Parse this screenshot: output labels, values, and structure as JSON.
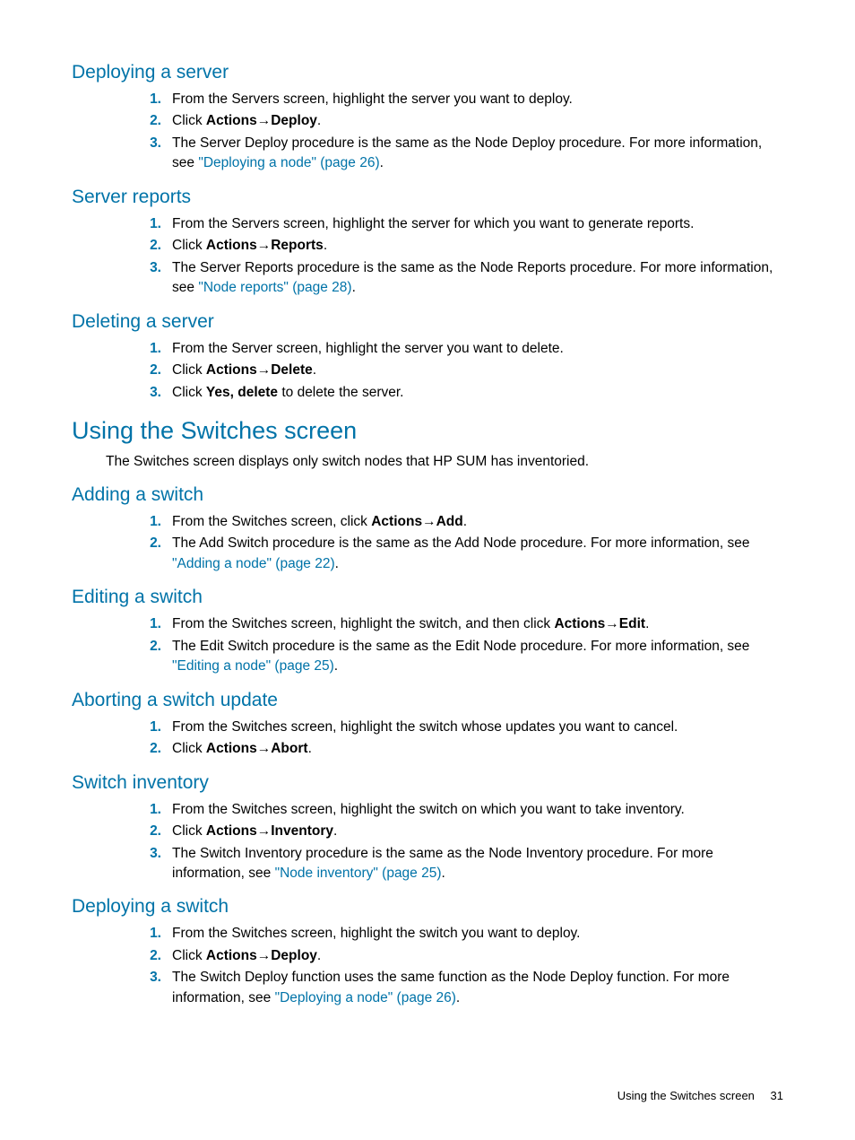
{
  "sections": {
    "deploying_server": {
      "title": "Deploying a server",
      "step1": "From the Servers screen, highlight the server you want to deploy.",
      "step2_pre": "Click ",
      "step2_b1": "Actions",
      "step2_b2": "Deploy",
      "step3_pre": "The Server Deploy procedure is the same as the Node Deploy procedure. For more information, see ",
      "step3_link": "\"Deploying a node\" (page 26)"
    },
    "server_reports": {
      "title": "Server reports",
      "step1": "From the Servers screen, highlight the server for which you want to generate reports.",
      "step2_pre": "Click ",
      "step2_b1": "Actions",
      "step2_b2": "Reports",
      "step3_pre": "The Server Reports procedure is the same as the Node Reports procedure. For more information, see ",
      "step3_link": "\"Node reports\" (page 28)"
    },
    "deleting_server": {
      "title": "Deleting a server",
      "step1": "From the Server screen, highlight the server you want to delete.",
      "step2_pre": "Click ",
      "step2_b1": "Actions",
      "step2_b2": "Delete",
      "step3_pre": "Click ",
      "step3_b": "Yes, delete",
      "step3_post": " to delete the server."
    },
    "using_switches": {
      "title": "Using the Switches screen",
      "intro": "The Switches screen displays only switch nodes that HP SUM has inventoried."
    },
    "adding_switch": {
      "title": "Adding a switch",
      "step1_pre": "From the Switches screen, click ",
      "step1_b1": "Actions",
      "step1_b2": "Add",
      "step2_pre": "The Add Switch procedure is the same as the Add Node procedure. For more information, see ",
      "step2_link": "\"Adding a node\" (page 22)"
    },
    "editing_switch": {
      "title": "Editing a switch",
      "step1_pre": "From the Switches screen, highlight the switch, and then click ",
      "step1_b1": "Actions",
      "step1_b2": "Edit",
      "step2_pre": "The Edit Switch procedure is the same as the Edit Node procedure. For more information, see ",
      "step2_link": "\"Editing a node\" (page 25)"
    },
    "aborting_switch": {
      "title": "Aborting a switch update",
      "step1": "From the Switches screen, highlight the switch whose updates you want to cancel.",
      "step2_pre": "Click ",
      "step2_b1": "Actions",
      "step2_b2": "Abort"
    },
    "switch_inventory": {
      "title": "Switch inventory",
      "step1": "From the Switches screen, highlight the switch on which you want to take inventory.",
      "step2_pre": "Click ",
      "step2_b1": "Actions",
      "step2_b2": "Inventory",
      "step3_pre": "The Switch Inventory procedure is the same as the Node Inventory procedure. For more information, see ",
      "step3_link": "\"Node inventory\" (page 25)"
    },
    "deploying_switch": {
      "title": "Deploying a switch",
      "step1": "From the Switches screen, highlight the switch you want to deploy.",
      "step2_pre": "Click ",
      "step2_b1": "Actions",
      "step2_b2": "Deploy",
      "step3_pre": "The Switch Deploy function uses the same function as the Node Deploy function. For more information, see ",
      "step3_link": "\"Deploying a node\" (page 26)"
    }
  },
  "nums": {
    "n1": "1.",
    "n2": "2.",
    "n3": "3."
  },
  "footer": {
    "text": "Using the Switches screen",
    "page": "31"
  },
  "period": "."
}
